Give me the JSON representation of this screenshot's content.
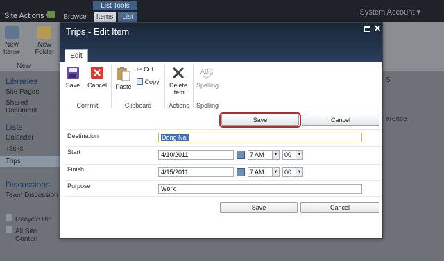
{
  "background": {
    "site_actions": "Site Actions ▾",
    "tabs": {
      "list_tools": "List Tools",
      "browse": "Browse",
      "items": "Items",
      "list": "List"
    },
    "account": "System Account ▾",
    "ribbon": {
      "new_item": "New Item▾",
      "new_folder": "New Folder",
      "group_new": "New"
    },
    "nav": {
      "libraries": "Libraries",
      "site_pages": "Site Pages",
      "shared_documents": "Shared Document",
      "lists": "Lists",
      "calendar": "Calendar",
      "tasks": "Tasks",
      "trips": "Trips",
      "discussions": "Discussions",
      "team_discussion": "Team Discussion",
      "recycle_bin": "Recycle Bin",
      "all_site_content": "All Site Conten"
    },
    "right_fragment": {
      "s": "S",
      "erence": "erence"
    }
  },
  "dialog": {
    "title": "Trips - Edit Item",
    "tab_edit": "Edit",
    "ribbon": {
      "save": "Save",
      "cancel": "Cancel",
      "paste": "Paste",
      "cut": "Cut",
      "copy": "Copy",
      "delete_item": "Delete Item",
      "spelling": "Spelling",
      "groups": {
        "commit": "Commit",
        "clipboard": "Clipboard",
        "actions": "Actions",
        "spelling": "Spelling"
      }
    },
    "form": {
      "save_top": "Save",
      "cancel_top": "Cancel",
      "destination_label": "Destination",
      "destination_value": "Dong Nai",
      "start_label": "Start",
      "start_date": "4/10/2011",
      "start_hour": "7 AM",
      "start_min": "00",
      "finish_label": "Finish",
      "finish_date": "4/15/2011",
      "finish_hour": "7 AM",
      "finish_min": "00",
      "purpose_label": "Purpose",
      "purpose_value": "Work",
      "save_bottom": "Save",
      "cancel_bottom": "Cancel"
    }
  }
}
